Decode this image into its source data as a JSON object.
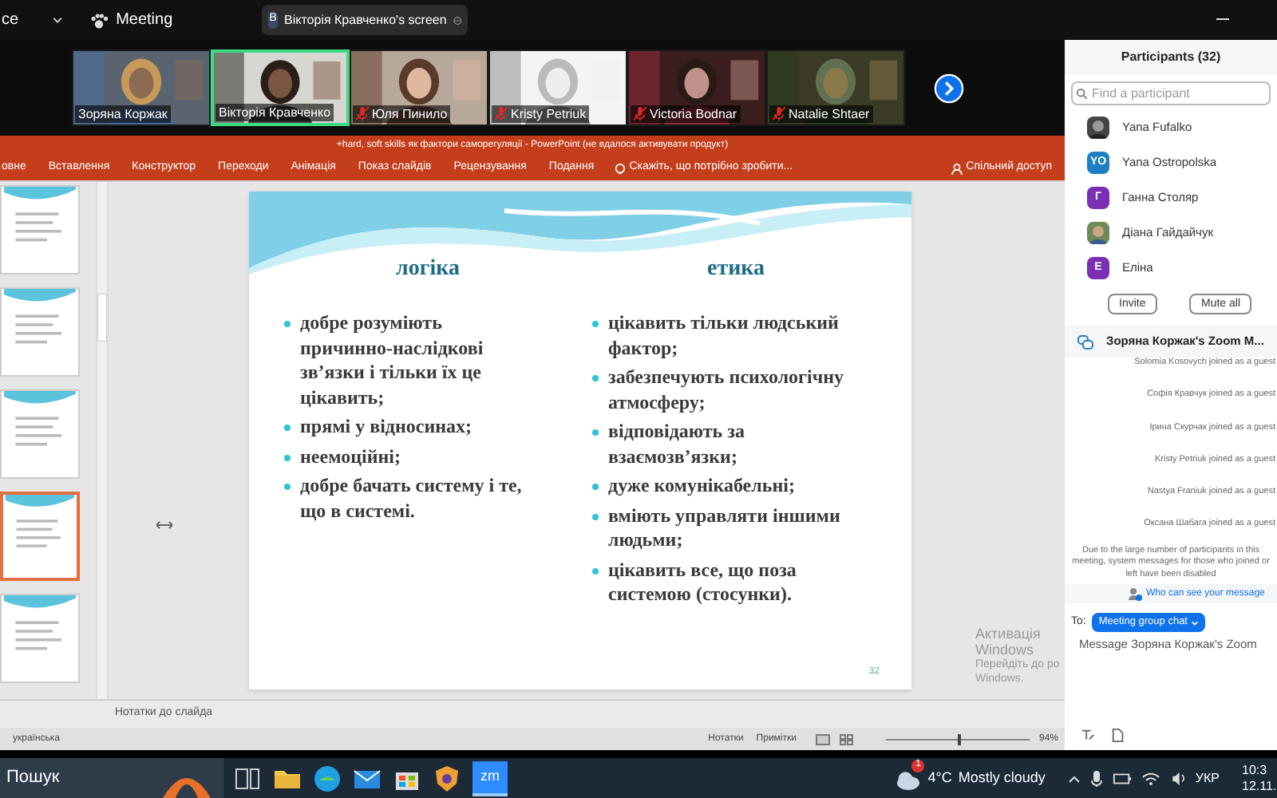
{
  "top_bar": {
    "title": "ce",
    "meeting_label": "Meeting",
    "share_badge": {
      "initial": "B",
      "label": "Вікторія Кравченко's screen"
    }
  },
  "videos": [
    {
      "name": "Зоряна Коржак",
      "muted": false,
      "selected": false,
      "kind": "picture"
    },
    {
      "name": "Вікторія Кравченко",
      "muted": false,
      "selected": true,
      "kind": "picture"
    },
    {
      "name": "Юля Пинило",
      "muted": true,
      "selected": false,
      "kind": "picture"
    },
    {
      "name": "Kristy Petriuk",
      "muted": true,
      "selected": false,
      "kind": "picture"
    },
    {
      "name": "Victoria Bodnar",
      "muted": true,
      "selected": false,
      "kind": "picture"
    },
    {
      "name": "Natalie Shtaer",
      "muted": true,
      "selected": false,
      "kind": "picture"
    }
  ],
  "powerpoint": {
    "title": "+hard, soft skills як фактори саморегуляції - PowerPoint (не вдалося активувати продукт)",
    "tabs": [
      {
        "label": "овне",
        "selected": false
      },
      {
        "label": "Вставлення",
        "selected": false
      },
      {
        "label": "Конструктор",
        "selected": false
      },
      {
        "label": "Переходи",
        "selected": false
      },
      {
        "label": "Анімація",
        "selected": false
      },
      {
        "label": "Показ слайдів",
        "selected": false
      },
      {
        "label": "Рецензування",
        "selected": false
      },
      {
        "label": "Подання",
        "selected": false
      }
    ],
    "tell_me": "Скажіть, що потрібно зробити...",
    "share": "Спільний доступ",
    "slides": [
      {
        "selected": false
      },
      {
        "selected": false
      },
      {
        "selected": false
      },
      {
        "selected": true
      },
      {
        "selected": false
      }
    ],
    "slide": {
      "columns": [
        {
          "heading": "логіка",
          "bullets": [
            "добре  розуміють причинно-наслідкові зв’язки і тільки їх це цікавить;",
            "прямі у відносинах;",
            "неемоційні;",
            "добре бачать систему і те, що в системі."
          ]
        },
        {
          "heading": "етика",
          "bullets": [
            "цікавить тільки людський фактор;",
            "забезпечують психологічну атмосферу;",
            "відповідають за взаємозв’язки;",
            "дуже комунікабельні;",
            "вміють управляти іншими людьми;",
            "цікавить все, що поза системою (стосунки)."
          ]
        }
      ],
      "number": "32"
    },
    "notes": "Нотатки до слайда",
    "status": {
      "language": "українська",
      "notes_button": "Нотатки",
      "comments_button": "Примітки",
      "zoom": "94%",
      "zoom_slider": {
        "level": 0.5
      }
    }
  },
  "activation": {
    "title": "Активація Windows",
    "lines": [
      "Перейдіть до ро",
      "Windows."
    ]
  },
  "participants": {
    "title": "Participants (32)",
    "search_placeholder": "Find a participant",
    "people": [
      {
        "name": "Yana Fufalko"
      },
      {
        "name": "Yana Ostropolska",
        "kind": "initials",
        "initials": "YO",
        "color": "#1f7fc4"
      },
      {
        "name": "Ганна Столяр",
        "kind": "initials",
        "initials": "Г",
        "color": "#7b2fb5"
      },
      {
        "name": "Діана Гайдайчук"
      },
      {
        "name": "Еліна",
        "kind": "initials",
        "initials": "E",
        "color": "#7b2fb5"
      }
    ],
    "buttons": [
      "Invite",
      "Mute all"
    ]
  },
  "chat": {
    "title": "Зоряна Коржак's Zoom M...",
    "messages": [
      "Solomia Kosovych joined as a guest",
      "Софія Кравчук joined as a guest",
      "Ірина Скурчак joined as a guest",
      "Kristy Petriuk joined as a guest",
      "Nastya Franiuk joined as a guest",
      "Оксана Шабага joined as a guest"
    ],
    "notice": "Due to the large number of participants in this meeting, system messages for those who joined or left have been disabled",
    "who_can_see": "Who can see your message",
    "to_label": "To:",
    "recipient": "Meeting group chat",
    "placeholder": "Message Зоряна Коржак's Zoom"
  },
  "taskbar": {
    "search": "Пошук",
    "apps": [
      {
        "kind": "taskview",
        "active": false
      },
      {
        "kind": "folder",
        "active": false
      },
      {
        "kind": "browser",
        "active": false
      },
      {
        "kind": "mail",
        "active": false
      },
      {
        "kind": "store",
        "active": false
      },
      {
        "kind": "shield",
        "active": false
      },
      {
        "kind": "zoom",
        "active": true,
        "label": "zm"
      }
    ],
    "weather_badge": "1",
    "temperature": "4°C",
    "condition": "Mostly cloudy",
    "language": "УКР",
    "time": "10:3",
    "date": "12.11."
  }
}
